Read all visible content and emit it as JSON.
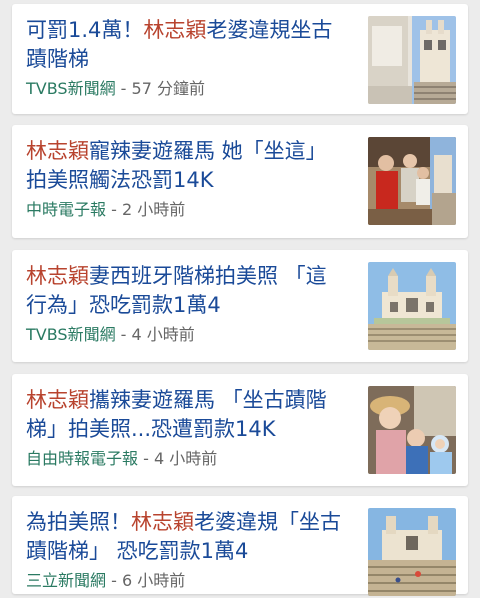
{
  "feed": {
    "items": [
      {
        "pre": "可罰1.4萬！",
        "hl": "林志穎",
        "post": "老婆違規坐古蹟階梯",
        "source": "TVBS新聞網",
        "sep": " - ",
        "time": "57 分鐘前",
        "thumb_icon": "spanish-steps-photo"
      },
      {
        "pre": "",
        "hl": "林志穎",
        "post": "寵辣妻遊羅馬 她「坐這」拍美照觸法恐罰14K",
        "source": "中時電子報",
        "sep": " - ",
        "time": "2 小時前",
        "thumb_icon": "family-photo"
      },
      {
        "pre": "",
        "hl": "林志穎",
        "post": "妻西班牙階梯拍美照 「這行為」恐吃罰款1萬4",
        "source": "TVBS新聞網",
        "sep": " - ",
        "time": "4 小時前",
        "thumb_icon": "church-steps-photo"
      },
      {
        "pre": "",
        "hl": "林志穎",
        "post": "攜辣妻遊羅馬 「坐古蹟階梯」拍美照...恐遭罰款14K",
        "source": "自由時報電子報",
        "sep": " - ",
        "time": "4 小時前",
        "thumb_icon": "woman-child-photo"
      },
      {
        "pre": "為拍美照！",
        "hl": "林志穎",
        "post": "老婆違規「坐古蹟階梯」 恐吃罰款1萬4",
        "source": "三立新聞網",
        "sep": " - ",
        "time": "6 小時前",
        "thumb_icon": "trinita-steps-photo"
      }
    ]
  },
  "colors": {
    "headline": "#1a4a98",
    "highlight": "#b8432e",
    "source": "#2a7a62",
    "time": "#666666",
    "background": "#ececec"
  }
}
